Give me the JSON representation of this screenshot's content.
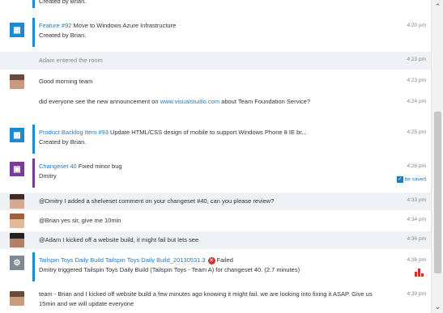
{
  "messages": {
    "m0": {
      "text": "Created by Brian."
    },
    "m1": {
      "title": "Feature #92",
      "text": " Move to Windows Azure Infrastructure",
      "sub": "Created by Brian.",
      "time": "4:20 pm"
    },
    "m2": {
      "text": "Adam entered the room",
      "time": "4:23 pm"
    },
    "m3": {
      "text": "Good morning team",
      "time": "4:23 pm"
    },
    "m4": {
      "pre": "did everyone see the new announcement on ",
      "link": "www.visualstudio.com",
      "post": " about Team Foundation Service?",
      "time": "4:24 pm"
    },
    "m5": {
      "title": "Product Backlog Item #93",
      "text": " Update HTML/CSS design of mobile to support Windows Phone 8 IE br...",
      "sub": "Created by Brian.",
      "time": "4:25 pm"
    },
    "m6": {
      "title": "Changeset 40",
      "text": " Fixed minor bug",
      "sub": "Dmitry",
      "time": "4:26 pm",
      "badge": "be saved"
    },
    "m7": {
      "text": "@Dmitry I added a shelveset comment on your changeset #40, can you please review?",
      "time": "4:33 pm"
    },
    "m8": {
      "text": "@Brian yes sir, give me 10min",
      "time": "4:34 pm"
    },
    "m9": {
      "text": "@Adam I kicked off a website build, it might fail but lets see",
      "time": "4:36 pm"
    },
    "m10": {
      "title": "Tailspin Toys Daily Build Tailspin Toys Daily Build_20130531.3",
      "status": "Failed",
      "sub": "Dmitry triggered Tailspin Toys Daily Build (Tailspin Toys - Team A) for changeset 40. (2.7 minutes)",
      "time": "4:36 pm"
    },
    "m11": {
      "text": "team - Brian and I kicked off website build a few minutes ago knowing it might fail. we are looking into fixing it ASAP. Give us 15min and we will update everyone",
      "time": "4:39 pm"
    }
  },
  "icons": {
    "work_item": "work-item-icon",
    "changeset": "changeset-icon",
    "build": "build-icon",
    "failed": "failed-icon",
    "chart": "chart-icon"
  },
  "colors": {
    "accent_blue": "#1e88d1",
    "accent_purple": "#7a3a9a",
    "failed_red": "#d32f2f"
  }
}
